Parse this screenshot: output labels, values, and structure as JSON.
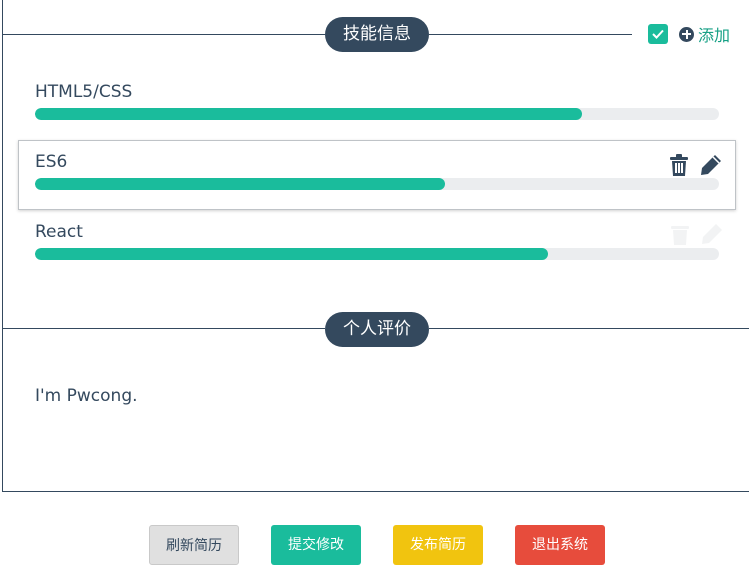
{
  "skills_section": {
    "title": "技能信息",
    "add_label": "添加",
    "items": [
      {
        "name": "HTML5/CSS",
        "level": 0.8
      },
      {
        "name": "ES6",
        "level": 0.6
      },
      {
        "name": "React",
        "level": 0.75
      }
    ]
  },
  "evaluation_section": {
    "title": "个人评价",
    "text": "I'm Pwcong."
  },
  "footer": {
    "refresh_label": "刷新简历",
    "submit_label": "提交修改",
    "publish_label": "发布简历",
    "logout_label": "退出系统"
  },
  "colors": {
    "accent": "#1abc9c",
    "dark": "#34495e",
    "track": "#ebedef",
    "publish": "#f1c40f",
    "logout": "#e74c3c"
  }
}
